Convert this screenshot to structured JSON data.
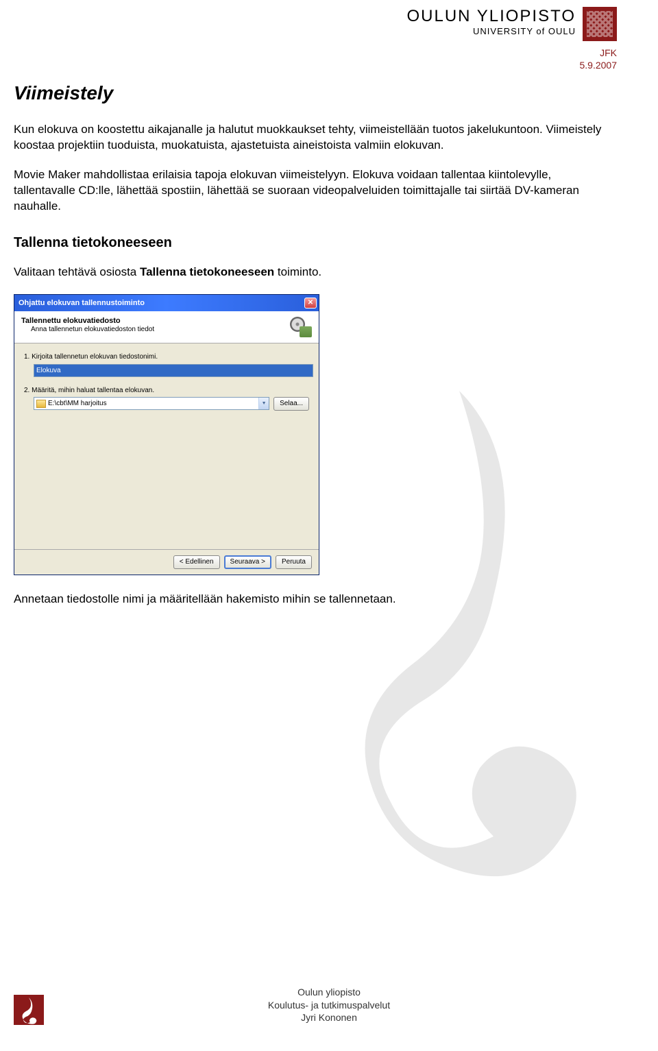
{
  "header": {
    "logo_main": "OULUN YLIOPISTO",
    "logo_sub": "UNIVERSITY of OULU",
    "meta_initials": "JFK",
    "meta_date": "5.9.2007"
  },
  "content": {
    "h1": "Viimeistely",
    "p1": "Kun elokuva on koostettu aikajanalle ja halutut muokkaukset tehty, viimeistellään tuotos jakelukuntoon. Viimeistely koostaa projektiin tuoduista, muokatuista, ajastetuista aineistoista valmiin elokuvan.",
    "p2": "Movie Maker mahdollistaa erilaisia tapoja elokuvan viimeistelyyn. Elokuva voidaan tallentaa kiintolevylle, tallentavalle CD:lle, lähettää spostiin, lähettää se suoraan videopalveluiden toimittajalle tai siirtää DV-kameran nauhalle.",
    "h2": "Tallenna tietokoneeseen",
    "p3_a": "Valitaan tehtävä osiosta ",
    "p3_b": "Tallenna tietokoneeseen",
    "p3_c": " toiminto.",
    "p4": "Annetaan tiedostolle nimi ja määritellään hakemisto mihin se tallennetaan."
  },
  "dialog": {
    "title": "Ohjattu elokuvan tallennustoiminto",
    "header_title": "Tallennettu elokuvatiedosto",
    "header_sub": "Anna tallennetun elokuvatiedoston tiedot",
    "step1_label": "1. Kirjoita tallennetun elokuvan tiedostonimi.",
    "step1_value": "Elokuva",
    "step2_label": "2. Määritä, mihin haluat tallentaa elokuvan.",
    "step2_value": "E:\\cbt\\MM harjoitus",
    "browse_btn": "Selaa...",
    "back_btn": "< Edellinen",
    "next_btn": "Seuraava >",
    "cancel_btn": "Peruuta"
  },
  "footer": {
    "line1": "Oulun yliopisto",
    "line2": "Koulutus- ja tutkimuspalvelut",
    "line3": "Jyri Kononen"
  }
}
